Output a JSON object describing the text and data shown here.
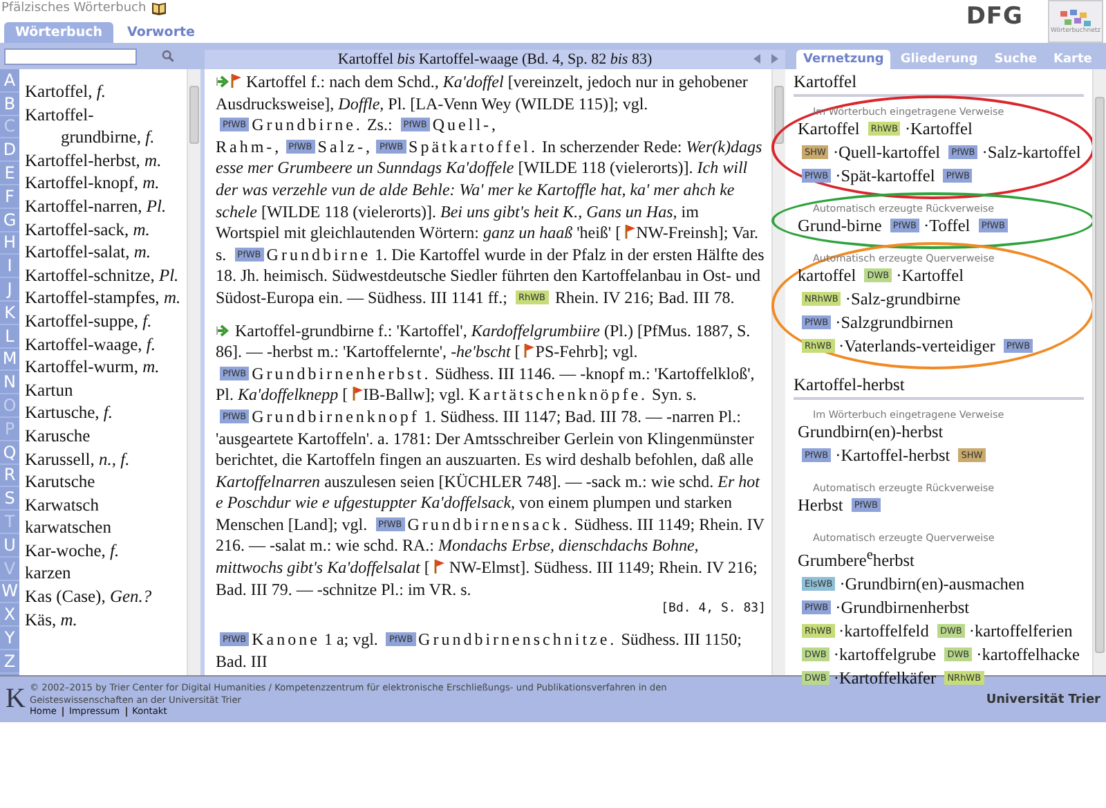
{
  "header": {
    "title": "Pfälzisches Wörterbuch",
    "tabs": [
      {
        "label": "Wörterbuch",
        "selected": true
      },
      {
        "label": "Vorworte",
        "selected": false
      }
    ],
    "logos": [
      "DFG",
      "Wörterbuchnetz"
    ]
  },
  "letters": [
    {
      "label": "A",
      "disabled": false
    },
    {
      "label": "B",
      "disabled": false
    },
    {
      "label": "C",
      "disabled": true
    },
    {
      "label": "D",
      "disabled": false
    },
    {
      "label": "E",
      "disabled": false
    },
    {
      "label": "F",
      "disabled": false
    },
    {
      "label": "G",
      "disabled": false
    },
    {
      "label": "H",
      "disabled": false
    },
    {
      "label": "I",
      "disabled": false
    },
    {
      "label": "J",
      "disabled": false
    },
    {
      "label": "K",
      "disabled": false
    },
    {
      "label": "L",
      "disabled": false
    },
    {
      "label": "M",
      "disabled": false
    },
    {
      "label": "N",
      "disabled": false
    },
    {
      "label": "O",
      "disabled": true
    },
    {
      "label": "P",
      "disabled": true
    },
    {
      "label": "Q",
      "disabled": false
    },
    {
      "label": "R",
      "disabled": false
    },
    {
      "label": "S",
      "disabled": false
    },
    {
      "label": "T",
      "disabled": true
    },
    {
      "label": "U",
      "disabled": false
    },
    {
      "label": "V",
      "disabled": true
    },
    {
      "label": "W",
      "disabled": false
    },
    {
      "label": "X",
      "disabled": false
    },
    {
      "label": "Y",
      "disabled": false
    },
    {
      "label": "Z",
      "disabled": false
    }
  ],
  "entries": [
    {
      "word": "Kartoffel,",
      "gender": "f."
    },
    {
      "word": "Kartoffel-grundbirne,",
      "gender": "f."
    },
    {
      "word": "Kartoffel-herbst,",
      "gender": "m."
    },
    {
      "word": "Kartoffel-knopf,",
      "gender": "m."
    },
    {
      "word": "Kartoffel-narren,",
      "gender": "Pl."
    },
    {
      "word": "Kartoffel-sack,",
      "gender": "m."
    },
    {
      "word": "Kartoffel-salat,",
      "gender": "m."
    },
    {
      "word": "Kartoffel-schnitze,",
      "gender": "Pl."
    },
    {
      "word": "Kartoffel-stampfes,",
      "gender": "m."
    },
    {
      "word": "Kartoffel-suppe,",
      "gender": "f."
    },
    {
      "word": "Kartoffel-waage,",
      "gender": "f."
    },
    {
      "word": "Kartoffel-wurm,",
      "gender": "m."
    },
    {
      "word": "Kartun"
    },
    {
      "word": "Kartusche,",
      "gender": "f."
    },
    {
      "word": "Karusche"
    },
    {
      "word": "Karussell,",
      "gender": "n.,  f."
    },
    {
      "word": "Karutsche"
    },
    {
      "word": "Karwatsch"
    },
    {
      "word": "karwatschen"
    },
    {
      "word": "Kar-woche,",
      "gender": "f."
    },
    {
      "word": "karzen"
    },
    {
      "word": "Kas (Case),",
      "gender": "Gen.?"
    },
    {
      "word": "Käs,",
      "gender": "m."
    }
  ],
  "article": {
    "title": "Kartoffel *bis* Kartoffel-waage (Bd. 4, Sp. 82 *bis* 83)",
    "paragraphs": [
      {
        "segments": [
          {
            "kind": "arrow"
          },
          {
            "kind": "flag"
          },
          {
            "kind": "text",
            "text": " Kartoffel f.: nach dem Schd., *Ka'doffel* [vereinzelt, jedoch nur in gehobener Ausdrucksweise], *Doffle,* Pl. [LA-Venn Wey (WILDE 115)]; vgl. "
          },
          {
            "kind": "badge",
            "text": "PfWB",
            "color": "#8fa3d8"
          },
          {
            "kind": "spaced",
            "text": "Grundbirne."
          },
          {
            "kind": "text",
            "text": " Zs.: "
          },
          {
            "kind": "badge",
            "text": "PfWB",
            "color": "#8fa3d8"
          },
          {
            "kind": "spaced",
            "text": "Quell-, Rahm-,"
          },
          {
            "kind": "badge",
            "text": "PfWB",
            "color": "#8fa3d8"
          },
          {
            "kind": "spaced",
            "text": "Salz-,"
          },
          {
            "kind": "badge",
            "text": "PfWB",
            "color": "#8fa3d8"
          },
          {
            "kind": "spaced",
            "text": "Spätkartoffel."
          },
          {
            "kind": "text",
            "text": " In scherzender Rede: *Wer(k)dags esse mer Grumbeere un Sunndags Ka'doffele* [WILDE 118 (vielerorts)]. *Ich will der was verzehle vun de alde Behle: Wa' mer ke Kartoffle hat, ka' mer ahch ke schele* [WILDE 118 (vielerorts)]. *Bei uns gibt's heit K., Gans un Has,* im Wortspiel mit gleichlautenden Wörtern: *ganz un haaß* 'heiß' [ "
          },
          {
            "kind": "flag"
          },
          {
            "kind": "text",
            "text": "NW-Freinsh]; Var. s. "
          },
          {
            "kind": "badge",
            "text": "PfWB",
            "color": "#8fa3d8"
          },
          {
            "kind": "spaced",
            "text": "Grundbirne"
          },
          {
            "kind": "text",
            "text": " 1. Die Kartoffel wurde in der Pfalz in der ersten Hälfte des 18. Jh. heimisch. Südwestdeutsche Siedler führten den Kartoffelanbau in Ost- und Südost-Europa ein. — Südhess. III 1141 ff.; "
          },
          {
            "kind": "badge",
            "text": "RhWB",
            "color": "#c5dc78"
          },
          {
            "kind": "text",
            "text": " Rhein. IV 216; Bad. III 78."
          }
        ]
      },
      {
        "segments": [
          {
            "kind": "arrow"
          },
          {
            "kind": "text",
            "text": " Kartoffel-grundbirne f.: 'Kartoffel', *Kardoffelgrumbiire* (Pl.) [PfMus. 1887, S. 86]. — -herbst m.: 'Kartoffelernte', *-he'bscht* [ "
          },
          {
            "kind": "flag"
          },
          {
            "kind": "text",
            "text": "PS-Fehrb]; vgl. "
          },
          {
            "kind": "badge",
            "text": "PfWB",
            "color": "#8fa3d8"
          },
          {
            "kind": "spaced",
            "text": "Grundbirnenherbst."
          },
          {
            "kind": "text",
            "text": " Südhess. III 1146. — -knopf m.: 'Kartoffelkloß', Pl. *Ka'doffelknepp* [ "
          },
          {
            "kind": "flag"
          },
          {
            "kind": "text",
            "text": "IB-Ballw]; vgl. "
          },
          {
            "kind": "spaced",
            "text": "Kartätschenknöpfe."
          },
          {
            "kind": "text",
            "text": " Syn. s. "
          },
          {
            "kind": "badge",
            "text": "PfWB",
            "color": "#8fa3d8"
          },
          {
            "kind": "spaced",
            "text": "Grundbirnenknopf"
          },
          {
            "kind": "text",
            "text": " 1. Südhess. III 1147; Bad. III 78. — -narren Pl.: 'ausgeartete Kartoffeln'. a. 1781: Der Amtsschreiber Gerlein von Klingenmünster berichtet, die Kartoffeln fingen an auszuarten. Es wird deshalb befohlen, daß alle *Kartoffelnarren* auszulesen seien [KÜCHLER 748]. — -sack m.: wie schd. *Er hot e Poschdur wie e ufgestuppter Ka'doffelsack,* von einem plumpen und starken Menschen [Land]; vgl. "
          },
          {
            "kind": "badge",
            "text": "PfWB",
            "color": "#8fa3d8"
          },
          {
            "kind": "spaced",
            "text": "Grundbirnensack."
          },
          {
            "kind": "text",
            "text": " Südhess. III 1149; Rhein. IV 216. — -salat m.: wie schd. RA.: *Mondachs Erbse, dienschdachs Bohne, mittwochs gibt's Ka'doffelsalat* [ "
          },
          {
            "kind": "flag"
          },
          {
            "kind": "text",
            "text": " NW-Elmst]. Südhess. III 1149; Rhein. IV 216; Bad. III 79. — -schnitze Pl.: im VR. s."
          },
          {
            "kind": "pageref",
            "text": "[Bd. 4, S. 83]"
          }
        ]
      },
      {
        "segments": [
          {
            "kind": "badge",
            "text": "PfWB",
            "color": "#8fa3d8"
          },
          {
            "kind": "spaced",
            "text": "Kanone"
          },
          {
            "kind": "text",
            "text": " 1 a; vgl. "
          },
          {
            "kind": "badge",
            "text": "PfWB",
            "color": "#8fa3d8"
          },
          {
            "kind": "spaced",
            "text": "Grundbirnenschnitze."
          },
          {
            "kind": "text",
            "text": " Südhess. III 1150; Bad. III"
          }
        ]
      }
    ]
  },
  "panel": {
    "tabs": [
      {
        "label": "Vernetzung",
        "selected": true
      },
      {
        "label": "Gliederung",
        "selected": false
      },
      {
        "label": "Suche",
        "selected": false
      },
      {
        "label": "Karte",
        "selected": false
      }
    ],
    "sections": [
      {
        "heading": "Kartoffel",
        "groups": [
          {
            "heading": "Im Wörterbuch eingetragene Verweise",
            "color": "#d9252b",
            "links": [
              {
                "text": "Kartoffel",
                "badge": "RhWB",
                "color": "#c5dc78"
              },
              {
                "text": "·Kartoffel",
                "badge": "SHW",
                "color": "#c9a96c"
              },
              {
                "text": "·Quell-kartoffel",
                "badge": "PfWB",
                "color": "#8fa3d8"
              },
              {
                "text": "·Salz-kartoffel",
                "badge": "PfWB",
                "color": "#8fa3d8"
              },
              {
                "text": "·Spät-kartoffel",
                "badge": "PfWB",
                "color": "#8fa3d8"
              }
            ]
          },
          {
            "heading": "Automatisch erzeugte Rückverweise",
            "color": "#2ea33c",
            "links": [
              {
                "text": "Grund-birne",
                "badge": "PfWB",
                "color": "#8fa3d8"
              },
              {
                "text": "·Toffel",
                "badge": "PfWB",
                "color": "#8fa3d8"
              }
            ]
          },
          {
            "heading": "Automatisch erzeugte Querverweise",
            "color": "#f08a24",
            "links": [
              {
                "text": "kartoffel",
                "badge": "DWB",
                "color": "#b9d98a"
              },
              {
                "text": "·Kartoffel",
                "badge": "NRhWB",
                "color": "#c5dc78"
              },
              {
                "text": "·Salz-grundbirne",
                "badge": "PfWB",
                "color": "#8fa3d8"
              },
              {
                "text": "·Salzgrundbirnen",
                "badge": "RhWB",
                "color": "#c5dc78"
              },
              {
                "text": "·Vaterlands-verteidiger",
                "badge": "PfWB",
                "color": "#8fa3d8"
              }
            ]
          }
        ]
      },
      {
        "heading": "Kartoffel-herbst",
        "groups": [
          {
            "heading": "Im Wörterbuch eingetragene Verweise",
            "links": [
              {
                "text": "Grundbirn(en)-herbst",
                "badge": "PfWB",
                "color": "#8fa3d8"
              },
              {
                "text": "·Kartoffel-herbst",
                "badge": "SHW",
                "color": "#c9a96c"
              }
            ]
          },
          {
            "heading": "Automatisch erzeugte Rückverweise",
            "links": [
              {
                "text": "Herbst",
                "badge": "PfWB",
                "color": "#8fa3d8"
              }
            ]
          },
          {
            "heading": "Automatisch erzeugte Querverweise",
            "links": [
              {
                "text": "Grumbere$^{e}$herbst",
                "badge": "ElsWB",
                "color": "#8fbfd6"
              },
              {
                "text": "·Grundbirn(en)-ausmachen",
                "badge": "PfWB",
                "color": "#8fa3d8"
              },
              {
                "text": "·Grundbirnenherbst",
                "badge": "RhWB",
                "color": "#c5dc78"
              },
              {
                "text": "·kartoffelfeld",
                "badge": "DWB",
                "color": "#b9d98a"
              },
              {
                "text": "·kartoffelferien",
                "badge": "DWB",
                "color": "#b9d98a"
              },
              {
                "text": "·kartoffelgrube",
                "badge": "DWB",
                "color": "#b9d98a"
              },
              {
                "text": "·kartoffelhacke",
                "badge": "DWB",
                "color": "#b9d98a"
              },
              {
                "text": "·Kartoffelkäfer",
                "badge": "NRhWB",
                "color": "#c5dc78"
              }
            ]
          }
        ]
      }
    ]
  },
  "footer": {
    "text": "© 2002–2015 by Trier Center for Digital Humanities / Kompetenzzentrum für elektronische Erschließungs- und Publikationsverfahren in den Geisteswissenschaften an der Universität Trier",
    "links": [
      "Home",
      "Impressum",
      "Kontakt"
    ],
    "logo_letter": "K",
    "university": "Universität Trier"
  }
}
